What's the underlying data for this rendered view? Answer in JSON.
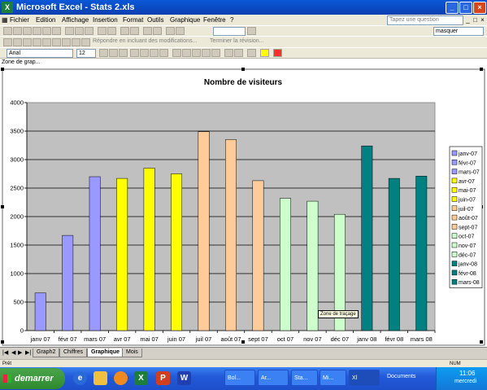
{
  "window": {
    "title": "Microsoft Excel - Stats 2.xls"
  },
  "menu": [
    "Fichier",
    "Edition",
    "Affichage",
    "Insertion",
    "Format",
    "Outils",
    "Graphique",
    "Fenêtre",
    "?"
  ],
  "help_box": {
    "placeholder": "Tapez une question"
  },
  "toolbar": {
    "review_text": "Répondre en incluant des modifications...",
    "end_review": "Terminer la révision...",
    "masquer": "masquer",
    "font_name": "Arial",
    "font_size": "12"
  },
  "name_box": {
    "value": "Zone de grap..."
  },
  "chart_data": {
    "type": "bar",
    "title": "Nombre de visiteurs",
    "categories": [
      "janv 07",
      "févr 07",
      "mars 07",
      "avr 07",
      "mai 07",
      "juin 07",
      "juil 07",
      "août 07",
      "sept 07",
      "oct 07",
      "nov 07",
      "déc 07",
      "janv 08",
      "févr 08",
      "mars 08"
    ],
    "values": [
      660,
      1670,
      2700,
      2670,
      2850,
      2750,
      3490,
      3350,
      2630,
      2320,
      2270,
      2040,
      3240,
      2670,
      2710
    ],
    "ylim": [
      0,
      4000
    ],
    "yticks": [
      "0",
      "500",
      "1000",
      "1500",
      "2000",
      "2500",
      "3000",
      "3500",
      "4000"
    ],
    "colors": [
      "#9999ff",
      "#9999ff",
      "#9999ff",
      "#ffff00",
      "#ffff00",
      "#ffff00",
      "#ffcc99",
      "#ffcc99",
      "#ffcc99",
      "#ccffcc",
      "#ccffcc",
      "#ccffcc",
      "#008080",
      "#008080",
      "#008080"
    ],
    "legend": [
      "janv-07",
      "févr-07",
      "mars-07",
      "avr-07",
      "mai-07",
      "juin-07",
      "juil-07",
      "août-07",
      "sept-07",
      "oct-07",
      "nov-07",
      "déc-07",
      "janv-08",
      "févr-08",
      "mars-08"
    ],
    "legend_position": "right",
    "plot_background": "#c0c0c0",
    "gridlines": true
  },
  "tooltip": "Zone de traçage",
  "tabs": [
    "Graph2",
    "Chiffres",
    "Graphique",
    "Mois"
  ],
  "active_tab": "Graphique",
  "status": {
    "left": "Prêt",
    "right": "NUM"
  },
  "taskbar": {
    "start": "demarrer",
    "tasks": [
      "Bol...",
      "Ar...",
      "Sta...",
      "Mi...",
      "Xl"
    ],
    "documents": "Documents",
    "clock": "11:06",
    "day": "mercredi"
  }
}
